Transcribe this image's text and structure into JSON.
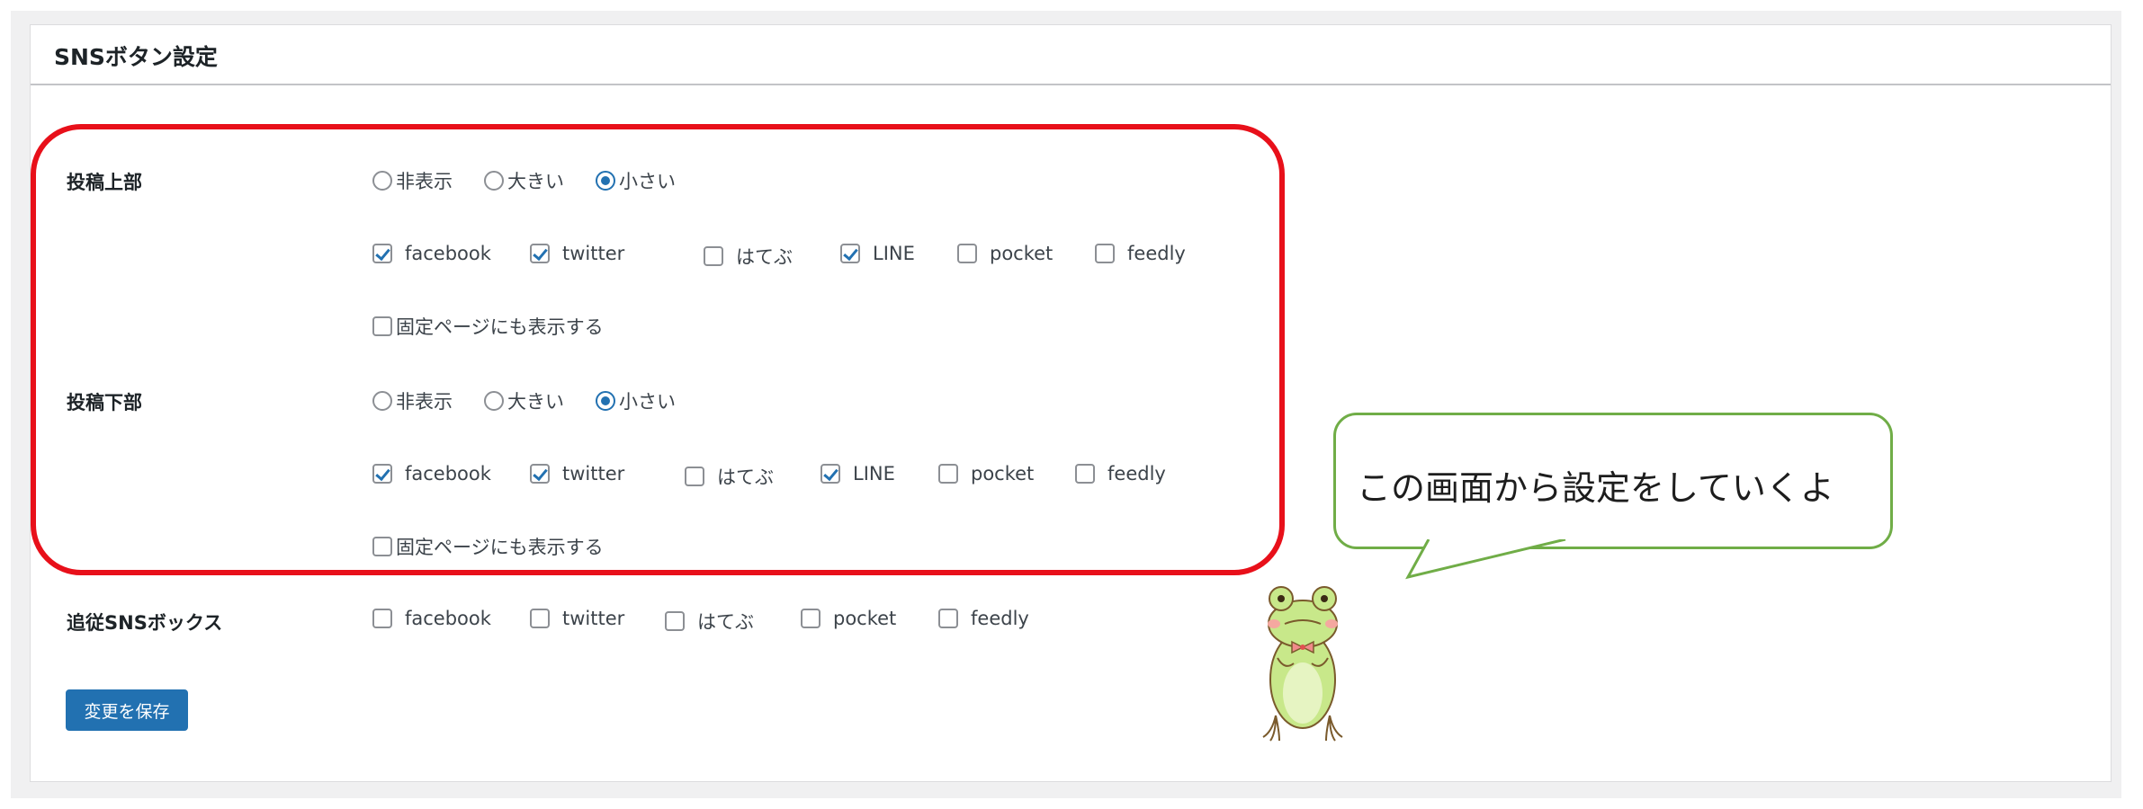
{
  "card": {
    "title": "SNSボタン設定"
  },
  "radio_options": [
    "非表示",
    "大きい",
    "小さい"
  ],
  "top_section": {
    "label": "投稿上部",
    "selected_size": "小さい",
    "buttons": [
      {
        "name": "facebook",
        "checked": true
      },
      {
        "name": "twitter",
        "checked": true
      },
      {
        "name": "はてぶ",
        "checked": false
      },
      {
        "name": "LINE",
        "checked": true
      },
      {
        "name": "pocket",
        "checked": false
      },
      {
        "name": "feedly",
        "checked": false
      }
    ],
    "fixed_page_label": "固定ページにも表示する",
    "fixed_page_checked": false
  },
  "bottom_section": {
    "label": "投稿下部",
    "selected_size": "小さい",
    "buttons": [
      {
        "name": "facebook",
        "checked": true
      },
      {
        "name": "twitter",
        "checked": true
      },
      {
        "name": "はてぶ",
        "checked": false
      },
      {
        "name": "LINE",
        "checked": true
      },
      {
        "name": "pocket",
        "checked": false
      },
      {
        "name": "feedly",
        "checked": false
      }
    ],
    "fixed_page_label": "固定ページにも表示する",
    "fixed_page_checked": false
  },
  "follow_section": {
    "label": "追従SNSボックス",
    "buttons": [
      {
        "name": "facebook",
        "checked": false
      },
      {
        "name": "twitter",
        "checked": false
      },
      {
        "name": "はてぶ",
        "checked": false
      },
      {
        "name": "pocket",
        "checked": false
      },
      {
        "name": "feedly",
        "checked": false
      }
    ]
  },
  "save_button": {
    "label": "変更を保存"
  },
  "speech_bubble": {
    "text": "この画面から設定をしていくよ"
  },
  "colors": {
    "accent": "#2271b1",
    "highlight_border": "#e8101a",
    "bubble_border": "#70ad47",
    "frog_body": "#c8e88a"
  }
}
